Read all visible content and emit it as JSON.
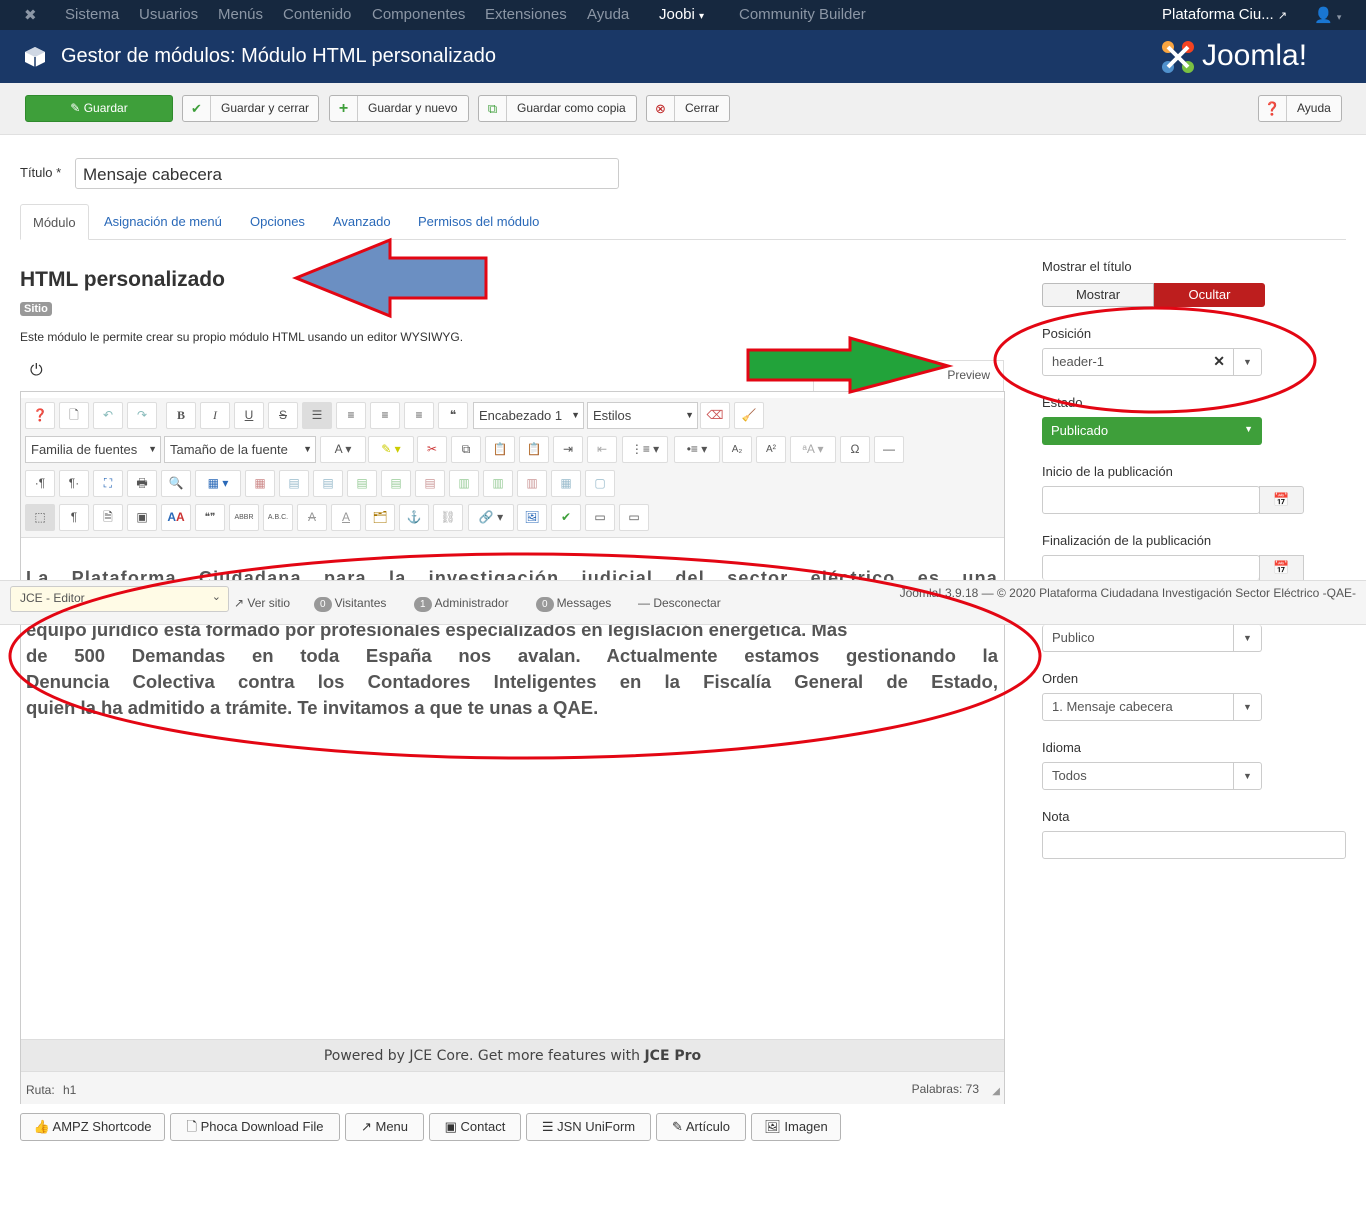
{
  "topnav": {
    "items": [
      "Sistema",
      "Usuarios",
      "Menús",
      "Contenido",
      "Componentes",
      "Extensiones",
      "Ayuda"
    ],
    "joobi": "Joobi",
    "community": "Community Builder",
    "site": "Plataforma Ciu...",
    "user_icon": "user-icon"
  },
  "header": {
    "title": "Gestor de módulos: Módulo HTML personalizado",
    "logo": "Joomla!"
  },
  "toolbar": {
    "save": "Guardar",
    "save_close": "Guardar y cerrar",
    "save_new": "Guardar y nuevo",
    "save_copy": "Guardar como copia",
    "close": "Cerrar",
    "help": "Ayuda"
  },
  "form": {
    "title_label": "Título *",
    "title_value": "Mensaje cabecera"
  },
  "tabs": [
    "Módulo",
    "Asignación de menú",
    "Opciones",
    "Avanzado",
    "Permisos del módulo"
  ],
  "module": {
    "heading": "HTML personalizado",
    "badge": "Sitio",
    "description": "Este módulo le permite crear su propio módulo HTML usando un editor WYSIWYG.",
    "preview": "Preview"
  },
  "editor": {
    "heading_select": "Encabezado 1",
    "styles_select": "Estilos",
    "font_family": "Familia de fuentes",
    "font_size": "Tamaño de la fuente",
    "content_top": "La Plataforma Ciudadana para la investigación judicial del sector eléctrico es una",
    "content_lines": [
      "equipo jurídico está formado por profesionales especializados en legislación energética. Más",
      "de 500 Demandas en toda España nos avalan. Actualmente estamos gestionando la",
      "Denuncia Colectiva contra los Contadores Inteligentes en la Fiscalía General de Estado,",
      "quien la ha admitido a trámite. Te invitamos a que te unas a QAE."
    ],
    "powered": "Powered by JCE Core. Get more features with ",
    "powered_bold": "JCE Pro",
    "path_label": "Ruta:",
    "path_value": "h1",
    "words": "Palabras: 73"
  },
  "statusbar": {
    "editor_select": "JCE - Editor",
    "view_site": "Ver sitio",
    "visitors_count": "0",
    "visitors": "Visitantes",
    "admin_count": "1",
    "admin": "Administrador",
    "messages_count": "0",
    "messages": "Messages",
    "logout": "Desconectar",
    "footer": "Joomla! 3.9.18  —  © 2020 Plataforma Ciudadana Investigación Sector Eléctrico -QAE-"
  },
  "sidebar": {
    "show_title": "Mostrar el título",
    "show": "Mostrar",
    "hide": "Ocultar",
    "position_label": "Posición",
    "position_value": "header-1",
    "status_label": "Estado",
    "status_value": "Publicado",
    "publish_up": "Inicio de la publicación",
    "publish_down": "Finalización de la publicación",
    "access_value": "Publico",
    "order_label": "Orden",
    "order_value": "1. Mensaje cabecera",
    "language_label": "Idioma",
    "language_value": "Todos",
    "note_label": "Nota"
  },
  "buttons": [
    "AMPZ Shortcode",
    "Phoca Download File",
    "Menu",
    "Contact",
    "JSN UniForm",
    "Artículo",
    "Imagen"
  ],
  "colors": {
    "nav": "#16283f",
    "header": "#1a3867",
    "green": "#3e9f3a",
    "red": "#bd1e1e",
    "annotation_red": "#e30613",
    "arrow_blue": "#6b8fc2",
    "arrow_green": "#22a33a"
  }
}
